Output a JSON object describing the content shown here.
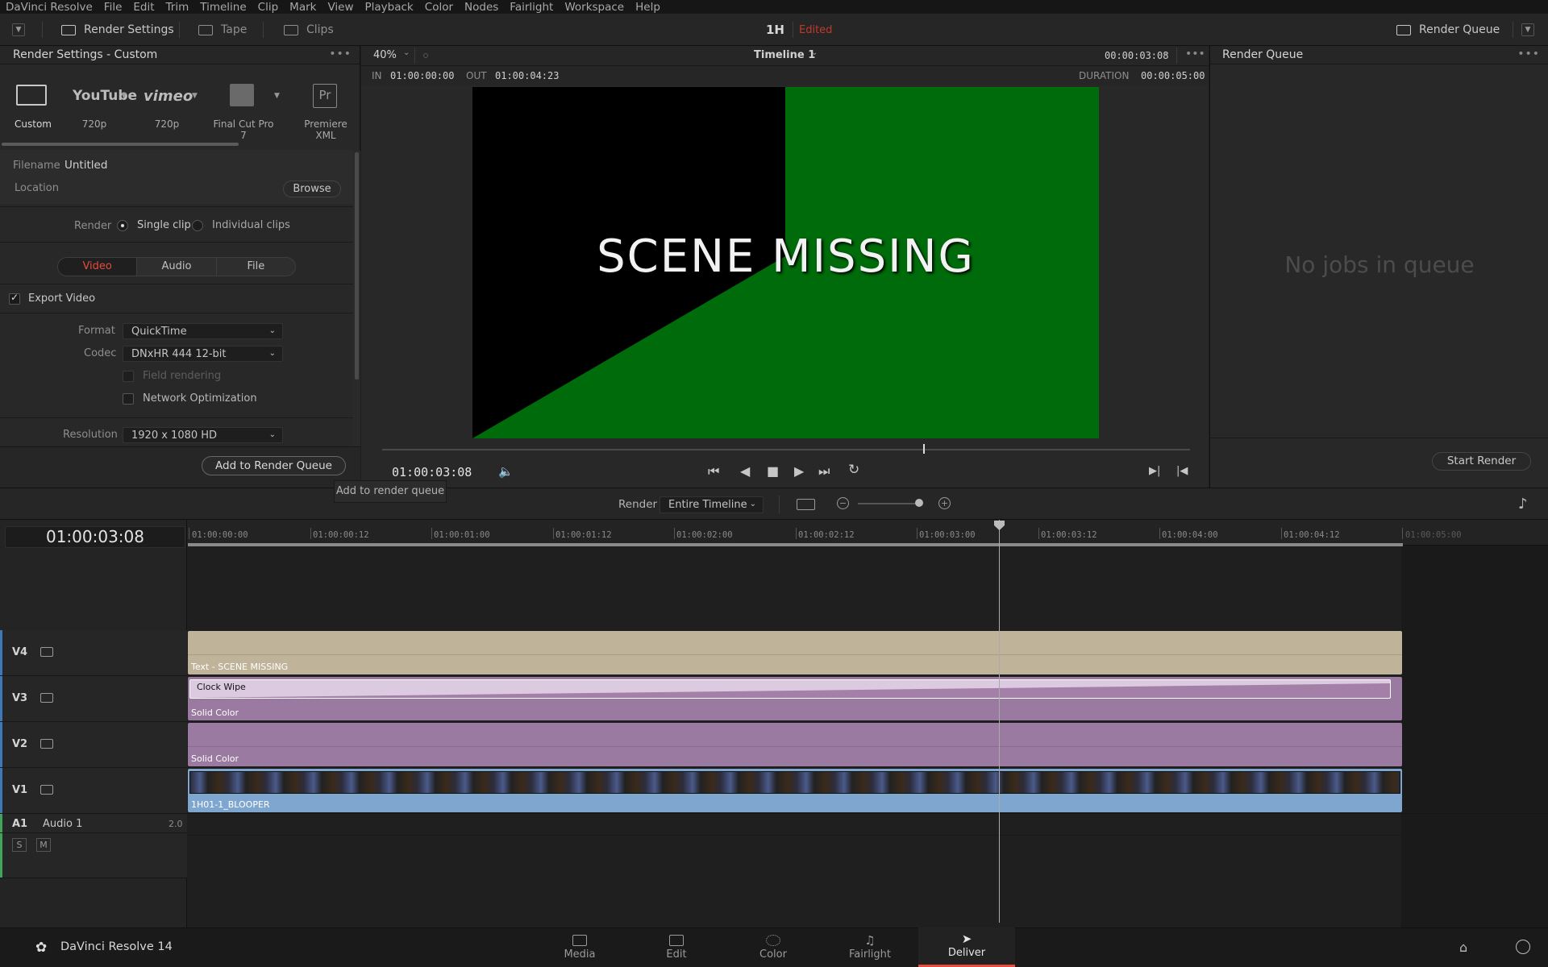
{
  "menubar": {
    "items": [
      "DaVinci Resolve",
      "File",
      "Edit",
      "Trim",
      "Timeline",
      "Clip",
      "Mark",
      "View",
      "Playback",
      "Color",
      "Nodes",
      "Fairlight",
      "Workspace",
      "Help"
    ]
  },
  "toolbar": {
    "render_settings": "Render Settings",
    "tape": "Tape",
    "clips": "Clips",
    "project": "1H",
    "edited": "Edited",
    "render_queue": "Render Queue"
  },
  "left_panel": {
    "title": "Render Settings - Custom",
    "presets": [
      {
        "name": "Custom",
        "sub": "Custom"
      },
      {
        "name": "YouTube",
        "sub": "720p"
      },
      {
        "name": "vimeo",
        "sub": "720p"
      },
      {
        "name": "Final Cut Pro 7",
        "sub": "Final Cut Pro 7"
      },
      {
        "name": "Pr",
        "sub": "Premiere XML"
      }
    ],
    "filename_label": "Filename",
    "filename": "Untitled",
    "location_label": "Location",
    "browse": "Browse",
    "render_label": "Render",
    "single_clip": "Single clip",
    "individual_clips": "Individual clips",
    "tabs": [
      "Video",
      "Audio",
      "File"
    ],
    "export_video": "Export Video",
    "format_label": "Format",
    "format": "QuickTime",
    "codec_label": "Codec",
    "codec": "DNxHR 444 12-bit",
    "field_rendering": "Field rendering",
    "network_opt": "Network Optimization",
    "resolution_label": "Resolution",
    "resolution": "1920 x 1080 HD",
    "add_queue": "Add to Render Queue",
    "tooltip": "Add to render queue"
  },
  "viewer": {
    "zoom": "40%",
    "timeline": "Timeline 1",
    "tc_top": "00:00:03:08",
    "in_label": "IN",
    "in": "01:00:00:00",
    "out_label": "OUT",
    "out": "01:00:04:23",
    "duration_label": "DURATION",
    "duration": "00:00:05:00",
    "overlay_text": "SCENE MISSING",
    "current_tc": "01:00:03:08"
  },
  "render_queue": {
    "title": "Render Queue",
    "empty": "No jobs in queue",
    "start": "Start Render"
  },
  "strip": {
    "render_label": "Render",
    "render_range": "Entire Timeline"
  },
  "timeline": {
    "current_tc": "01:00:03:08",
    "ruler": [
      "01:00:00:00",
      "01:00:00:12",
      "01:00:01:00",
      "01:00:01:12",
      "01:00:02:00",
      "01:00:02:12",
      "01:00:03:00",
      "01:00:03:12",
      "01:00:04:00",
      "01:00:04:12",
      "01:00:05:00"
    ],
    "tracks": [
      {
        "name": "V4",
        "clip": "Text - SCENE MISSING",
        "color": "#bfb49a"
      },
      {
        "name": "V3",
        "clip": "Solid Color",
        "transition": "Clock Wipe",
        "color": "#9a7aa0"
      },
      {
        "name": "V2",
        "clip": "Solid Color",
        "color": "#9a7aa0"
      },
      {
        "name": "V1",
        "clip": "1H01-1_BLOOPER",
        "color": "#7ea6cf"
      }
    ],
    "audio": {
      "name": "A1",
      "label": "Audio 1",
      "ch": "2.0",
      "s": "S",
      "m": "M"
    }
  },
  "pages": [
    "Media",
    "Edit",
    "Color",
    "Fairlight",
    "Deliver"
  ],
  "app_name": "DaVinci Resolve 14",
  "colors": {
    "accent": "#e64b3c",
    "edited": "#c0392b"
  }
}
